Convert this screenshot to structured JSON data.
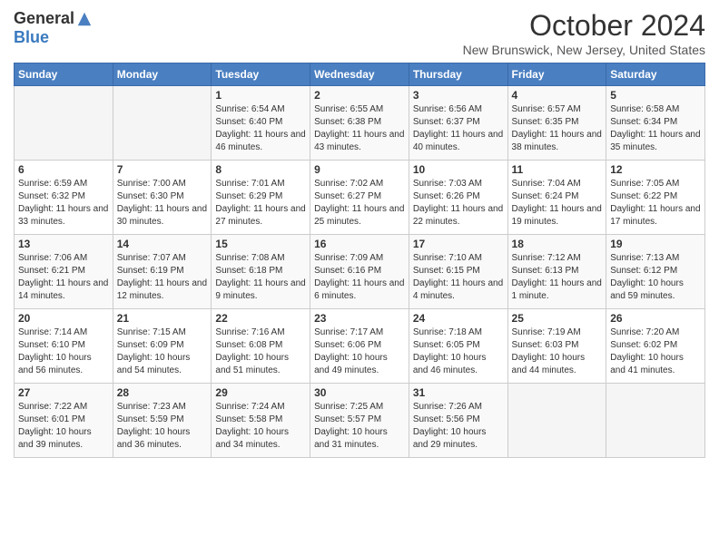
{
  "logo": {
    "general": "General",
    "blue": "Blue"
  },
  "title": "October 2024",
  "location": "New Brunswick, New Jersey, United States",
  "days_of_week": [
    "Sunday",
    "Monday",
    "Tuesday",
    "Wednesday",
    "Thursday",
    "Friday",
    "Saturday"
  ],
  "weeks": [
    [
      {
        "day": "",
        "sunrise": "",
        "sunset": "",
        "daylight": ""
      },
      {
        "day": "",
        "sunrise": "",
        "sunset": "",
        "daylight": ""
      },
      {
        "day": "1",
        "sunrise": "Sunrise: 6:54 AM",
        "sunset": "Sunset: 6:40 PM",
        "daylight": "Daylight: 11 hours and 46 minutes."
      },
      {
        "day": "2",
        "sunrise": "Sunrise: 6:55 AM",
        "sunset": "Sunset: 6:38 PM",
        "daylight": "Daylight: 11 hours and 43 minutes."
      },
      {
        "day": "3",
        "sunrise": "Sunrise: 6:56 AM",
        "sunset": "Sunset: 6:37 PM",
        "daylight": "Daylight: 11 hours and 40 minutes."
      },
      {
        "day": "4",
        "sunrise": "Sunrise: 6:57 AM",
        "sunset": "Sunset: 6:35 PM",
        "daylight": "Daylight: 11 hours and 38 minutes."
      },
      {
        "day": "5",
        "sunrise": "Sunrise: 6:58 AM",
        "sunset": "Sunset: 6:34 PM",
        "daylight": "Daylight: 11 hours and 35 minutes."
      }
    ],
    [
      {
        "day": "6",
        "sunrise": "Sunrise: 6:59 AM",
        "sunset": "Sunset: 6:32 PM",
        "daylight": "Daylight: 11 hours and 33 minutes."
      },
      {
        "day": "7",
        "sunrise": "Sunrise: 7:00 AM",
        "sunset": "Sunset: 6:30 PM",
        "daylight": "Daylight: 11 hours and 30 minutes."
      },
      {
        "day": "8",
        "sunrise": "Sunrise: 7:01 AM",
        "sunset": "Sunset: 6:29 PM",
        "daylight": "Daylight: 11 hours and 27 minutes."
      },
      {
        "day": "9",
        "sunrise": "Sunrise: 7:02 AM",
        "sunset": "Sunset: 6:27 PM",
        "daylight": "Daylight: 11 hours and 25 minutes."
      },
      {
        "day": "10",
        "sunrise": "Sunrise: 7:03 AM",
        "sunset": "Sunset: 6:26 PM",
        "daylight": "Daylight: 11 hours and 22 minutes."
      },
      {
        "day": "11",
        "sunrise": "Sunrise: 7:04 AM",
        "sunset": "Sunset: 6:24 PM",
        "daylight": "Daylight: 11 hours and 19 minutes."
      },
      {
        "day": "12",
        "sunrise": "Sunrise: 7:05 AM",
        "sunset": "Sunset: 6:22 PM",
        "daylight": "Daylight: 11 hours and 17 minutes."
      }
    ],
    [
      {
        "day": "13",
        "sunrise": "Sunrise: 7:06 AM",
        "sunset": "Sunset: 6:21 PM",
        "daylight": "Daylight: 11 hours and 14 minutes."
      },
      {
        "day": "14",
        "sunrise": "Sunrise: 7:07 AM",
        "sunset": "Sunset: 6:19 PM",
        "daylight": "Daylight: 11 hours and 12 minutes."
      },
      {
        "day": "15",
        "sunrise": "Sunrise: 7:08 AM",
        "sunset": "Sunset: 6:18 PM",
        "daylight": "Daylight: 11 hours and 9 minutes."
      },
      {
        "day": "16",
        "sunrise": "Sunrise: 7:09 AM",
        "sunset": "Sunset: 6:16 PM",
        "daylight": "Daylight: 11 hours and 6 minutes."
      },
      {
        "day": "17",
        "sunrise": "Sunrise: 7:10 AM",
        "sunset": "Sunset: 6:15 PM",
        "daylight": "Daylight: 11 hours and 4 minutes."
      },
      {
        "day": "18",
        "sunrise": "Sunrise: 7:12 AM",
        "sunset": "Sunset: 6:13 PM",
        "daylight": "Daylight: 11 hours and 1 minute."
      },
      {
        "day": "19",
        "sunrise": "Sunrise: 7:13 AM",
        "sunset": "Sunset: 6:12 PM",
        "daylight": "Daylight: 10 hours and 59 minutes."
      }
    ],
    [
      {
        "day": "20",
        "sunrise": "Sunrise: 7:14 AM",
        "sunset": "Sunset: 6:10 PM",
        "daylight": "Daylight: 10 hours and 56 minutes."
      },
      {
        "day": "21",
        "sunrise": "Sunrise: 7:15 AM",
        "sunset": "Sunset: 6:09 PM",
        "daylight": "Daylight: 10 hours and 54 minutes."
      },
      {
        "day": "22",
        "sunrise": "Sunrise: 7:16 AM",
        "sunset": "Sunset: 6:08 PM",
        "daylight": "Daylight: 10 hours and 51 minutes."
      },
      {
        "day": "23",
        "sunrise": "Sunrise: 7:17 AM",
        "sunset": "Sunset: 6:06 PM",
        "daylight": "Daylight: 10 hours and 49 minutes."
      },
      {
        "day": "24",
        "sunrise": "Sunrise: 7:18 AM",
        "sunset": "Sunset: 6:05 PM",
        "daylight": "Daylight: 10 hours and 46 minutes."
      },
      {
        "day": "25",
        "sunrise": "Sunrise: 7:19 AM",
        "sunset": "Sunset: 6:03 PM",
        "daylight": "Daylight: 10 hours and 44 minutes."
      },
      {
        "day": "26",
        "sunrise": "Sunrise: 7:20 AM",
        "sunset": "Sunset: 6:02 PM",
        "daylight": "Daylight: 10 hours and 41 minutes."
      }
    ],
    [
      {
        "day": "27",
        "sunrise": "Sunrise: 7:22 AM",
        "sunset": "Sunset: 6:01 PM",
        "daylight": "Daylight: 10 hours and 39 minutes."
      },
      {
        "day": "28",
        "sunrise": "Sunrise: 7:23 AM",
        "sunset": "Sunset: 5:59 PM",
        "daylight": "Daylight: 10 hours and 36 minutes."
      },
      {
        "day": "29",
        "sunrise": "Sunrise: 7:24 AM",
        "sunset": "Sunset: 5:58 PM",
        "daylight": "Daylight: 10 hours and 34 minutes."
      },
      {
        "day": "30",
        "sunrise": "Sunrise: 7:25 AM",
        "sunset": "Sunset: 5:57 PM",
        "daylight": "Daylight: 10 hours and 31 minutes."
      },
      {
        "day": "31",
        "sunrise": "Sunrise: 7:26 AM",
        "sunset": "Sunset: 5:56 PM",
        "daylight": "Daylight: 10 hours and 29 minutes."
      },
      {
        "day": "",
        "sunrise": "",
        "sunset": "",
        "daylight": ""
      },
      {
        "day": "",
        "sunrise": "",
        "sunset": "",
        "daylight": ""
      }
    ]
  ]
}
